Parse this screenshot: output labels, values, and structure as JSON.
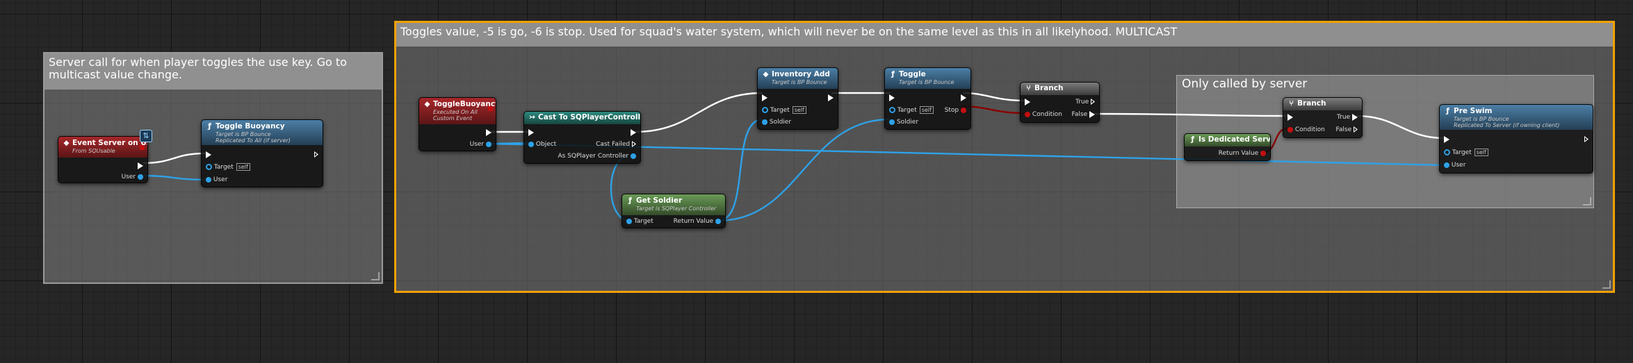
{
  "comments": {
    "server_call": "Server call for when player toggles the use key. Go to multicast value change.",
    "toggles_value": "Toggles value, -5 is go, -6 is stop. Used for squad's water system, which will never be on the same level as this in all likelyhood. MULTICAST",
    "only_called_by_server": "Only called by server"
  },
  "nodes": {
    "event_server_on_used": {
      "title": "Event Server on Used",
      "subtitle": "From SQUsable",
      "user": "User"
    },
    "toggle_buoyancy_call": {
      "title": "Toggle Buoyancy",
      "subtitle1": "Target is BP Bounce",
      "subtitle2": "Replicated To All (if server)",
      "target": "Target",
      "self": "self",
      "user": "User"
    },
    "toggle_buoyancy_event": {
      "title": "ToggleBuoyancy",
      "subtitle1": "Executed On All",
      "subtitle2": "Custom Event",
      "user": "User"
    },
    "cast_to_sqplayercontroller": {
      "title": "Cast To SQPlayerController",
      "object": "Object",
      "cast_failed": "Cast Failed",
      "as_sqplayercontroller": "As SQPlayer Controller"
    },
    "get_soldier": {
      "title": "Get Soldier",
      "subtitle": "Target is SQPlayer Controller",
      "target": "Target",
      "return_value": "Return Value"
    },
    "inventory_add": {
      "title": "Inventory Add",
      "subtitle": "Target is BP Bounce",
      "target": "Target",
      "self": "self",
      "soldier": "Soldier"
    },
    "toggle": {
      "title": "Toggle",
      "subtitle": "Target is BP Bounce",
      "target": "Target",
      "self": "self",
      "soldier": "Soldier",
      "stop": "Stop"
    },
    "branch1": {
      "title": "Branch",
      "condition": "Condition",
      "true": "True",
      "false": "False"
    },
    "is_dedicated_server": {
      "title": "Is Dedicated Server",
      "return_value": "Return Value"
    },
    "branch2": {
      "title": "Branch",
      "condition": "Condition",
      "true": "True",
      "false": "False"
    },
    "pre_swim": {
      "title": "Pre Swim",
      "subtitle1": "Target is BP Bounce",
      "subtitle2": "Replicated To Server (if owning client)",
      "target": "Target",
      "self": "self",
      "user": "User"
    }
  },
  "colors": {
    "exec_wire": "#ffffff",
    "object_wire": "#2ea2e8",
    "bool_wire": "#8b0000",
    "selection": "#f0a000"
  },
  "icons": {
    "event": "event-diamond-icon",
    "function": "function-f-icon",
    "cast": "cast-arrows-icon",
    "branch": "branch-icon",
    "network": "network-replication-icon"
  }
}
